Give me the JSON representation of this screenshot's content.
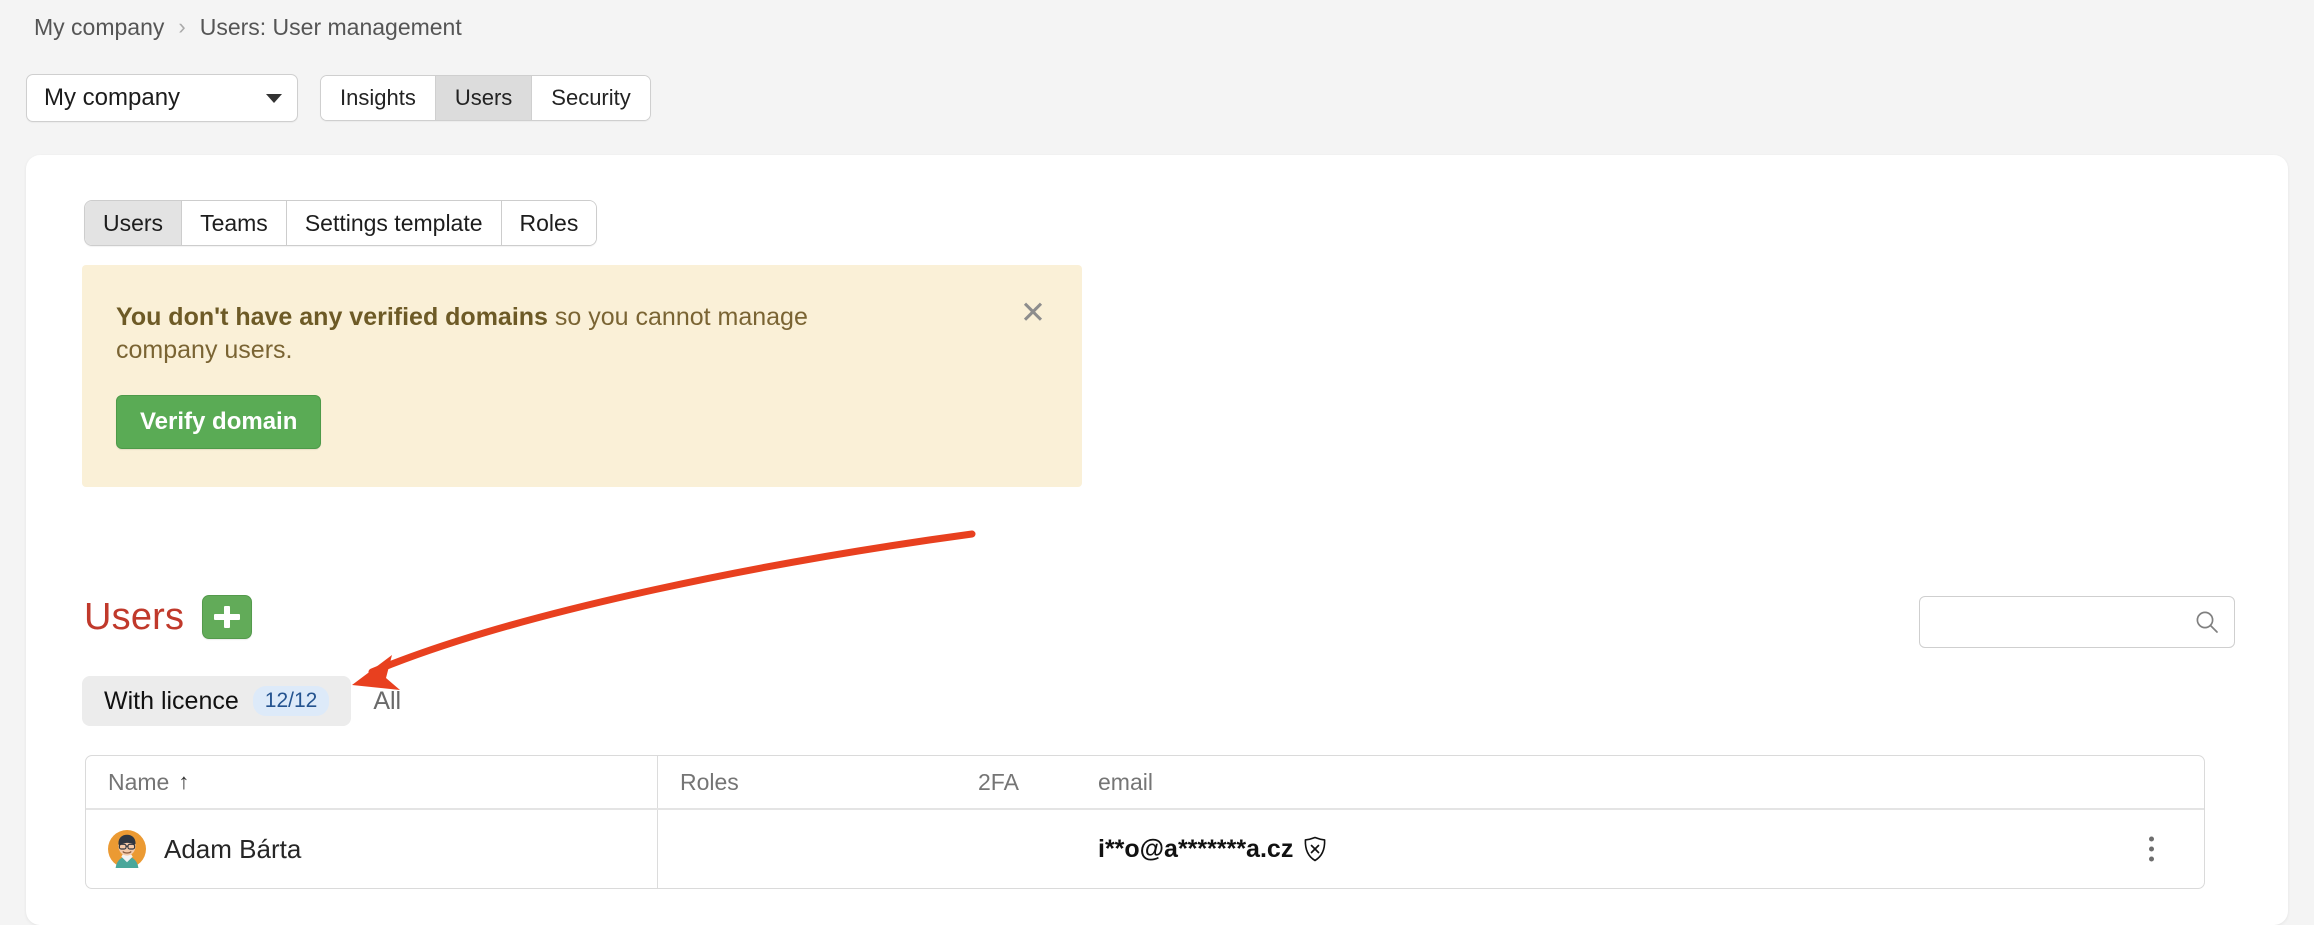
{
  "breadcrumb": {
    "items": [
      {
        "label": "My company"
      },
      {
        "label": "Users: User management"
      }
    ],
    "separator": "›"
  },
  "topbar": {
    "company_select": {
      "value": "My company"
    },
    "sections": [
      {
        "label": "Insights",
        "active": false
      },
      {
        "label": "Users",
        "active": true
      },
      {
        "label": "Security",
        "active": false
      }
    ]
  },
  "inner_tabs": [
    {
      "label": "Users",
      "active": true
    },
    {
      "label": "Teams",
      "active": false
    },
    {
      "label": "Settings template",
      "active": false
    },
    {
      "label": "Roles",
      "active": false
    }
  ],
  "banner": {
    "bold_text": "You don't have any verified domains",
    "rest_text": " so you cannot manage company users.",
    "button_label": "Verify domain",
    "close_label": "✕",
    "bg_color": "#faf0d7",
    "button_color": "#5aab55"
  },
  "users_section": {
    "title": "Users",
    "title_color": "#c0392b",
    "add_button_label": "+",
    "filters": [
      {
        "label": "With licence",
        "count": "12/12",
        "active": true
      },
      {
        "label": "All",
        "count": "",
        "active": false
      }
    ],
    "search": {
      "value": "",
      "placeholder": ""
    }
  },
  "table": {
    "columns": [
      {
        "key": "name",
        "label": "Name",
        "sort": "↑"
      },
      {
        "key": "roles",
        "label": "Roles",
        "sort": ""
      },
      {
        "key": "twofa",
        "label": "2FA",
        "sort": ""
      },
      {
        "key": "email",
        "label": "email",
        "sort": ""
      }
    ],
    "rows": [
      {
        "name": "Adam Bárta",
        "roles": "",
        "twofa": "",
        "email": "i**o@a*******a.cz",
        "email_status_icon": "shield-x-icon",
        "menu_icon": "kebab-menu-icon"
      }
    ]
  },
  "annotation": {
    "arrow_color": "#e8401f",
    "points_to": "With licence 12/12 filter pill"
  }
}
